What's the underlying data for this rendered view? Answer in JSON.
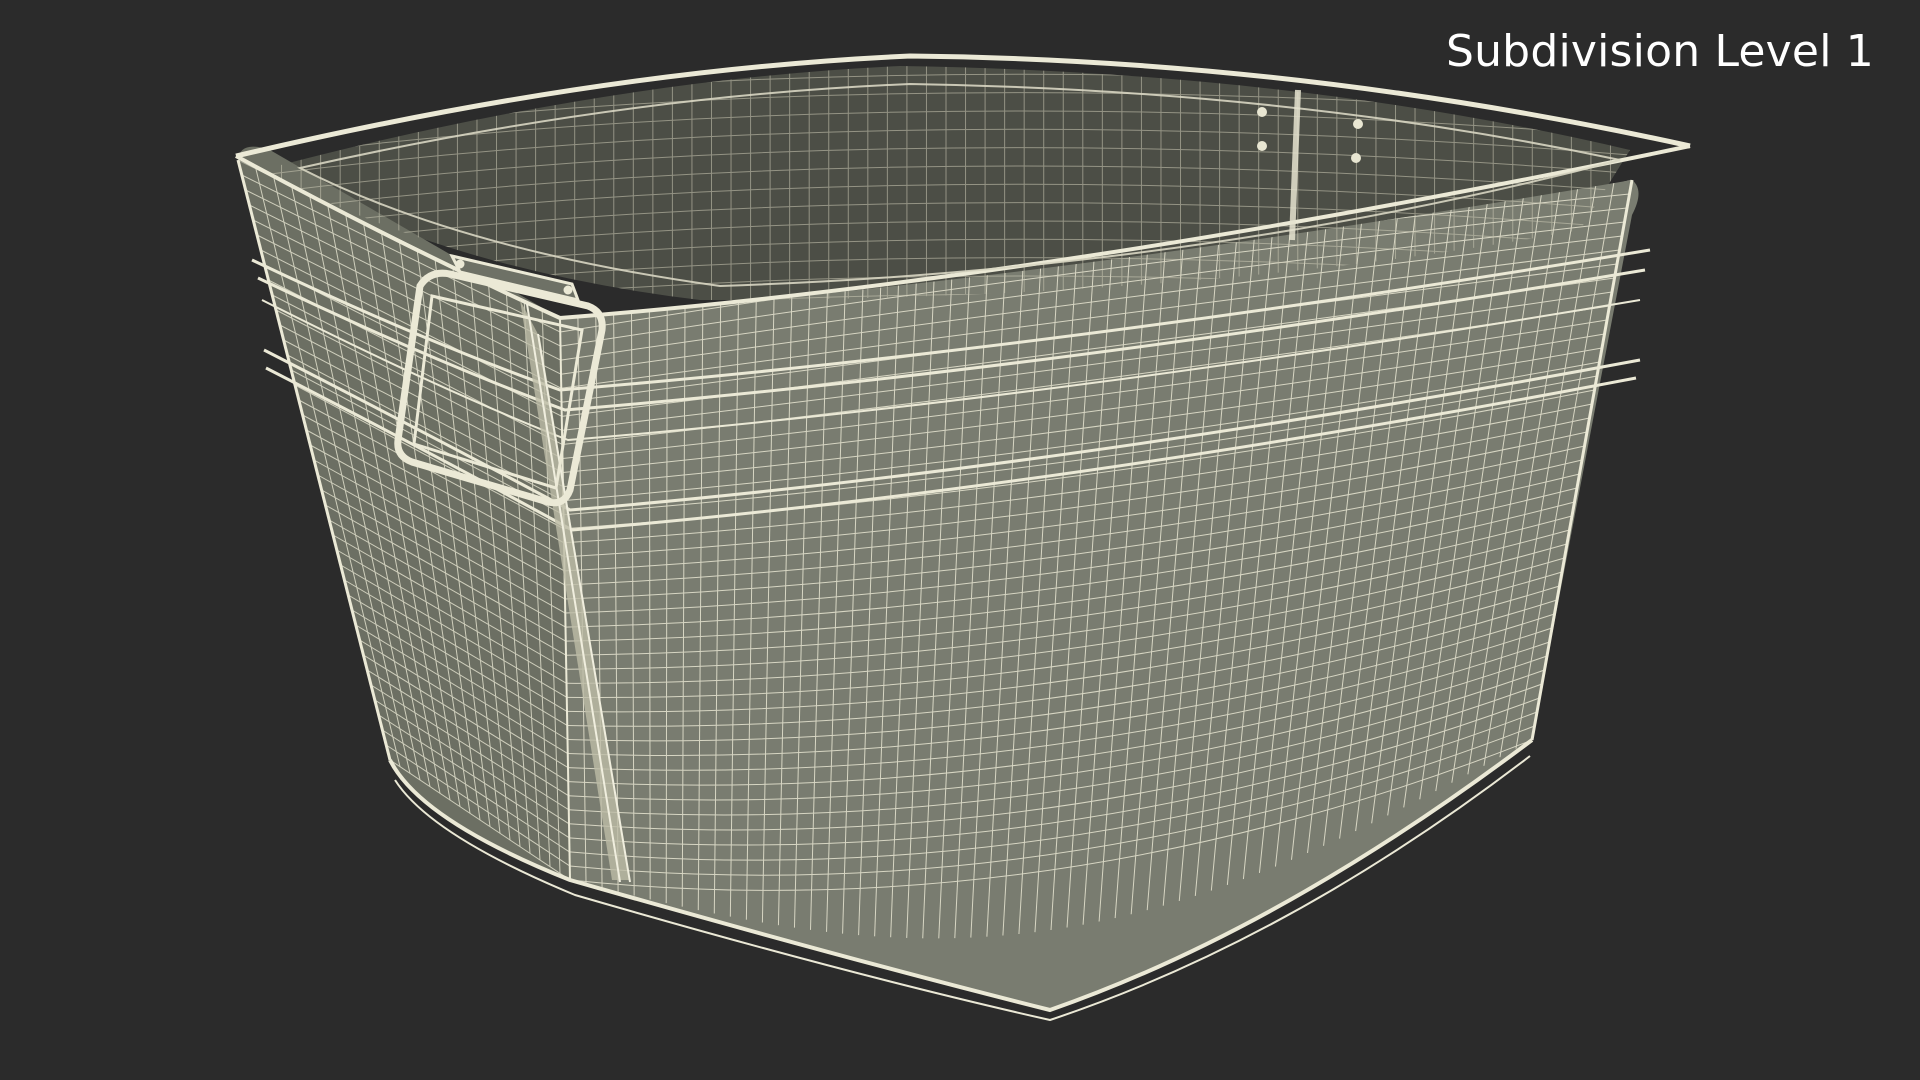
{
  "overlay": {
    "label": "Subdivision Level 1"
  },
  "scene": {
    "subject": "wireframe-metal-tub-with-handle",
    "colors": {
      "background": "#2b2b2b",
      "surface": "#777a6e",
      "surface_dark": "#54564c",
      "interior": "#4a4c44",
      "wire": "#e8e6d2",
      "rim": "#d8d6c2"
    }
  }
}
